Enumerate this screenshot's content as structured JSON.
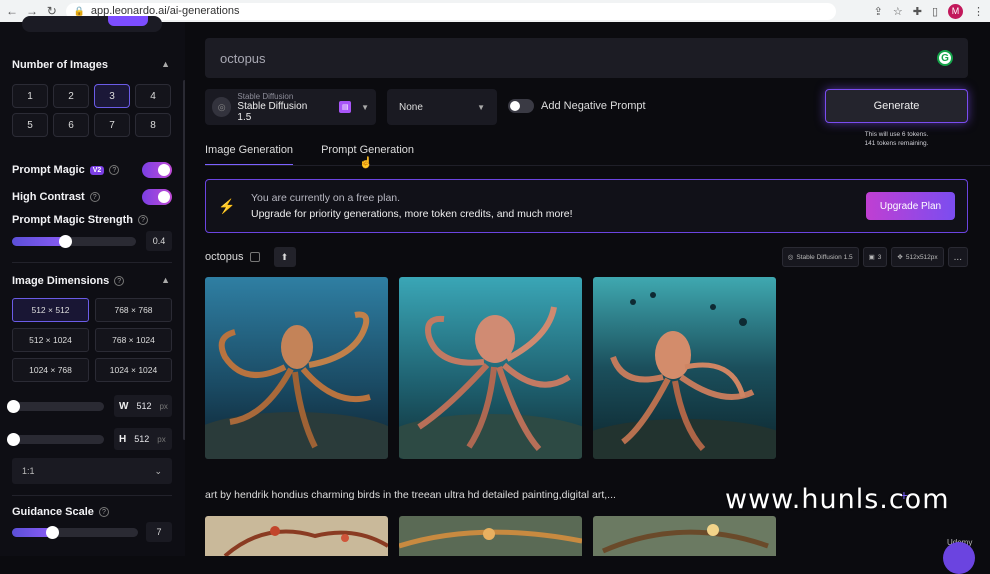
{
  "browser": {
    "url": "app.leonardo.ai/ai-generations",
    "avatar_letter": "M"
  },
  "sidebar": {
    "number_of_images": {
      "title": "Number of Images",
      "options": [
        "1",
        "2",
        "3",
        "4",
        "5",
        "6",
        "7",
        "8"
      ],
      "selected": "3"
    },
    "prompt_magic": {
      "label": "Prompt Magic",
      "badge": "V2",
      "on": true
    },
    "high_contrast": {
      "label": "High Contrast",
      "on": true
    },
    "prompt_magic_strength": {
      "label": "Prompt Magic Strength",
      "value": "0.4",
      "fraction": 0.4
    },
    "image_dimensions": {
      "title": "Image Dimensions",
      "options": [
        "512 × 512",
        "768 × 768",
        "512 × 1024",
        "768 × 1024",
        "1024 × 768",
        "1024 × 1024"
      ],
      "selected": "512 × 512"
    },
    "width": {
      "key": "W",
      "value": "512",
      "unit": "px"
    },
    "height": {
      "key": "H",
      "value": "512",
      "unit": "px"
    },
    "aspect_ratio": "1:1",
    "guidance_scale": {
      "label": "Guidance Scale",
      "value": "7",
      "fraction": 0.3
    }
  },
  "main": {
    "prompt": "octopus",
    "model": {
      "category": "Stable Diffusion",
      "name": "Stable Diffusion 1.5"
    },
    "style": "None",
    "negative_prompt_label": "Add Negative Prompt",
    "generate_label": "Generate",
    "tokens_line1": "This will use 6 tokens.",
    "tokens_line2": "141 tokens remaining.",
    "tabs": [
      "Image Generation",
      "Prompt Generation"
    ],
    "banner": {
      "line1": "You are currently on a free plan.",
      "line2": "Upgrade for priority generations, more token credits, and much more!",
      "button": "Upgrade Plan"
    },
    "generation1": {
      "title": "octopus",
      "chips": [
        "Stable Diffusion 1.5",
        "3",
        "512x512px",
        "..."
      ]
    },
    "generation2": {
      "title": "art by hendrik hondius charming birds in the treean ultra hd detailed painting,digital art,..."
    }
  },
  "watermark": "www.hunls.com",
  "watermark2": "Udemy",
  "colors": {
    "accent": "#7b61ff",
    "upgrade_start": "#c03fd2",
    "upgrade_end": "#7b4df0"
  }
}
